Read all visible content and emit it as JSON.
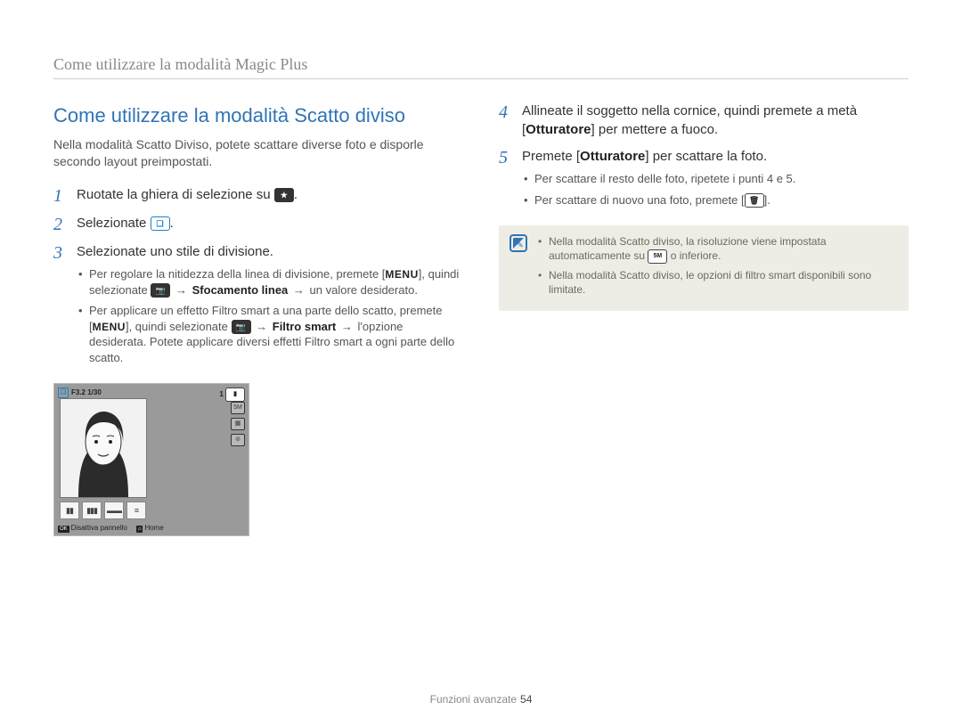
{
  "chapter": "Come utilizzare la modalità Magic Plus",
  "section_title": "Come utilizzare la modalità Scatto diviso",
  "intro": "Nella modalità Scatto Diviso, potete scattare diverse foto e disporle secondo layout preimpostati.",
  "steps_left": [
    {
      "num": "1",
      "text_pre": "Ruotate la ghiera di selezione su ",
      "icon": "★",
      "text_post": "."
    },
    {
      "num": "2",
      "text_pre": "Selezionate ",
      "icon": "❏",
      "text_post": "."
    },
    {
      "num": "3",
      "text_pre": "Selezionate uno stile di divisione.",
      "bullets": [
        {
          "pre": "Per regolare la nitidezza della linea di divisione, premete [",
          "menu": "MENU",
          "mid1": "], quindi selezionate ",
          "cam": "📷",
          "arrow1": "→",
          "bold1": "Sfocamento linea",
          "arrow2": "→",
          "tail": " un valore desiderato."
        },
        {
          "pre": "Per applicare un effetto Filtro smart a una parte dello scatto, premete [",
          "menu": "MENU",
          "mid1": "], quindi selezionate ",
          "cam": "📷",
          "arrow1": "→",
          "bold1": "Filtro smart",
          "arrow2": "→",
          "tail": " l'opzione desiderata. Potete applicare diversi effetti Filtro smart a ogni parte dello scatto."
        }
      ]
    }
  ],
  "steps_right": [
    {
      "num": "4",
      "parts": [
        {
          "t": "Allineate il soggetto nella cornice, quindi premete a metà ["
        },
        {
          "bold": "Otturatore"
        },
        {
          "t": "] per mettere a fuoco."
        }
      ]
    },
    {
      "num": "5",
      "parts": [
        {
          "t": "Premete ["
        },
        {
          "bold": "Otturatore"
        },
        {
          "t": "] per scattare la foto."
        }
      ],
      "bullets_simple": [
        "Per scattare il resto delle foto, ripetete i punti 4 e 5.",
        {
          "pre": "Per scattare di nuovo una foto, premete [",
          "icon": "🗑",
          "post": "]."
        }
      ]
    }
  ],
  "note": [
    {
      "pre": "Nella modalità Scatto diviso, la risoluzione viene impostata automaticamente su ",
      "icon": "5M",
      "post": " o inferiore."
    },
    {
      "pre": "Nella modalità Scatto diviso, le opzioni di filtro smart disponibili sono limitate."
    }
  ],
  "thumb": {
    "top_left_label": "F3.2  1/30",
    "top_right_label": "1",
    "footer_left_key": "OK",
    "footer_left_label": "Disattiva pannello",
    "footer_right_key": "⌂",
    "footer_right_label": "Home"
  },
  "footer_section": "Funzioni avanzate",
  "footer_page": "54"
}
